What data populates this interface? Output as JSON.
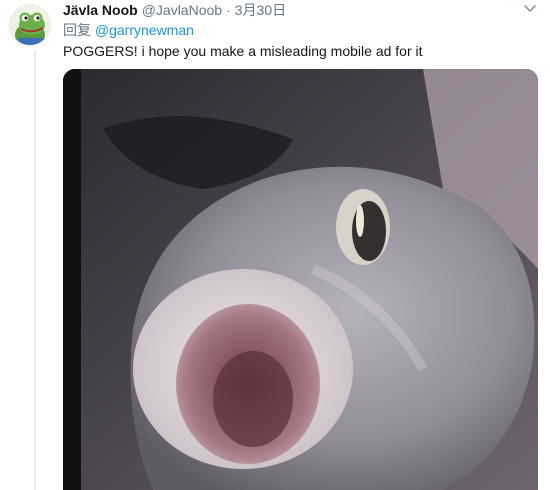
{
  "tweet": {
    "display_name": "Jävla Noob",
    "handle": "@JavlaNoob",
    "separator": "·",
    "date": "3月30日",
    "reply_prefix": "回复 ",
    "reply_to": "@garrynewman",
    "text": "POGGERS! i hope you make a misleading mobile ad for it"
  },
  "icons": {
    "avatar": "frog-avatar",
    "menu": "chevron-down-icon"
  },
  "colors": {
    "name": "#14171a",
    "secondary": "#657786",
    "link": "#1b95e0",
    "thread_line": "#e6ecf0"
  }
}
